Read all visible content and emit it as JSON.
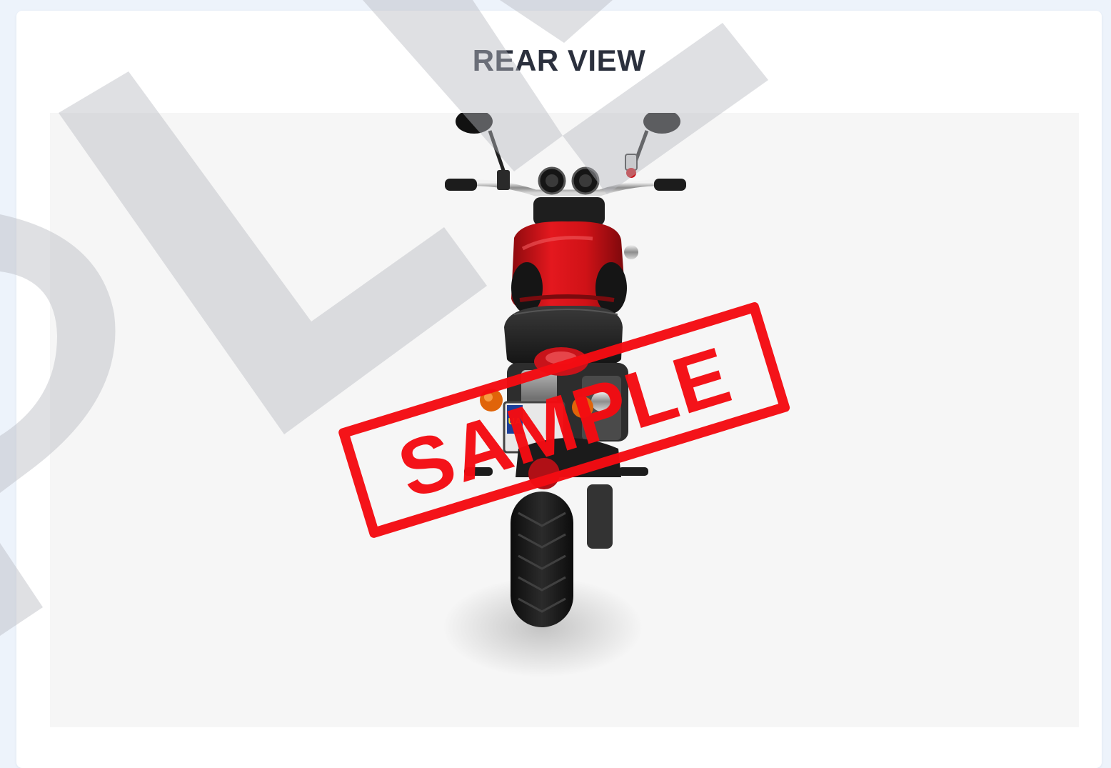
{
  "view": {
    "title": "REAR VIEW"
  },
  "photo": {
    "subject": "motorcycle-rear-view",
    "plate_text": "UA",
    "stamp_text": "SAMPLE",
    "stamp_color": "#f40c12",
    "background_color": "#f6f6f6",
    "body_color": "#d9141a"
  },
  "watermark": {
    "color": "#c8cbd0"
  }
}
